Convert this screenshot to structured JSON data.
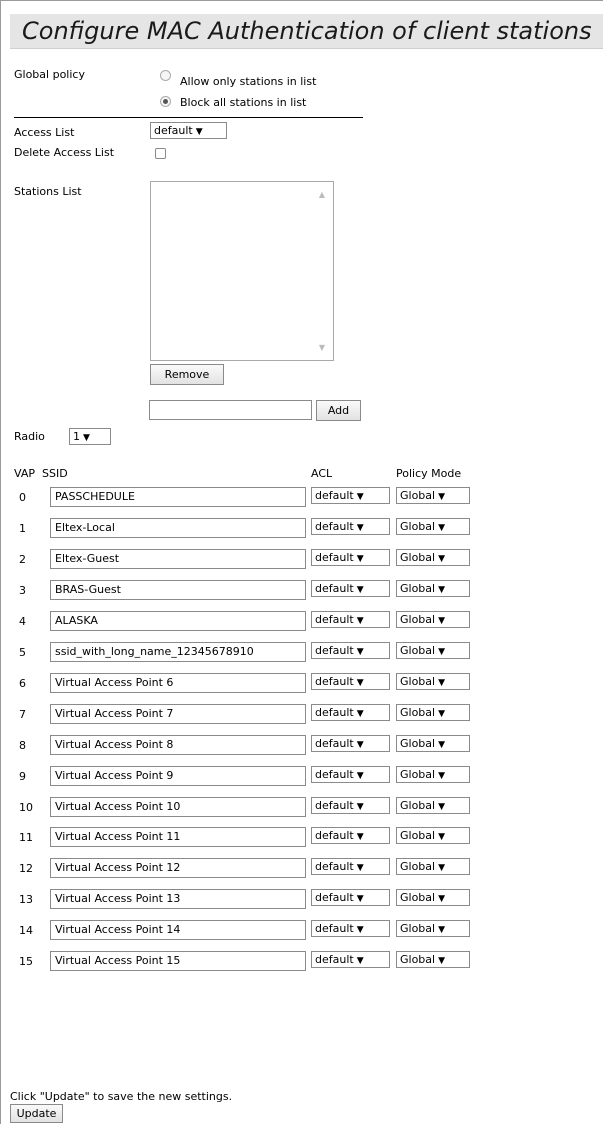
{
  "title": "Configure MAC Authentication of client stations",
  "global_policy": {
    "label": "Global policy",
    "options": [
      {
        "label": "Allow only stations in list",
        "selected": false
      },
      {
        "label": "Block all stations in list",
        "selected": true
      }
    ]
  },
  "access_list": {
    "label": "Access List",
    "value": "default"
  },
  "delete_access_list": {
    "label": "Delete Access List",
    "checked": false
  },
  "stations_list": {
    "label": "Stations List",
    "remove_label": "Remove",
    "add_value": "",
    "add_label": "Add"
  },
  "radio": {
    "label": "Radio",
    "value": "1"
  },
  "table": {
    "headers": {
      "vap": "VAP",
      "ssid": "SSID",
      "acl": "ACL",
      "policy": "Policy Mode"
    },
    "rows": [
      {
        "vap": "0",
        "ssid": "PASSCHEDULE",
        "acl": "default",
        "policy": "Global"
      },
      {
        "vap": "1",
        "ssid": "Eltex-Local",
        "acl": "default",
        "policy": "Global"
      },
      {
        "vap": "2",
        "ssid": "Eltex-Guest",
        "acl": "default",
        "policy": "Global"
      },
      {
        "vap": "3",
        "ssid": "BRAS-Guest",
        "acl": "default",
        "policy": "Global"
      },
      {
        "vap": "4",
        "ssid": "ALASKA",
        "acl": "default",
        "policy": "Global"
      },
      {
        "vap": "5",
        "ssid": "ssid_with_long_name_12345678910",
        "acl": "default",
        "policy": "Global"
      },
      {
        "vap": "6",
        "ssid": "Virtual Access Point 6",
        "acl": "default",
        "policy": "Global"
      },
      {
        "vap": "7",
        "ssid": "Virtual Access Point 7",
        "acl": "default",
        "policy": "Global"
      },
      {
        "vap": "8",
        "ssid": "Virtual Access Point 8",
        "acl": "default",
        "policy": "Global"
      },
      {
        "vap": "9",
        "ssid": "Virtual Access Point 9",
        "acl": "default",
        "policy": "Global"
      },
      {
        "vap": "10",
        "ssid": "Virtual Access Point 10",
        "acl": "default",
        "policy": "Global"
      },
      {
        "vap": "11",
        "ssid": "Virtual Access Point 11",
        "acl": "default",
        "policy": "Global"
      },
      {
        "vap": "12",
        "ssid": "Virtual Access Point 12",
        "acl": "default",
        "policy": "Global"
      },
      {
        "vap": "13",
        "ssid": "Virtual Access Point 13",
        "acl": "default",
        "policy": "Global"
      },
      {
        "vap": "14",
        "ssid": "Virtual Access Point 14",
        "acl": "default",
        "policy": "Global"
      },
      {
        "vap": "15",
        "ssid": "Virtual Access Point 15",
        "acl": "default",
        "policy": "Global"
      }
    ]
  },
  "footer": {
    "note": "Click \"Update\" to save the new settings.",
    "update_label": "Update"
  }
}
